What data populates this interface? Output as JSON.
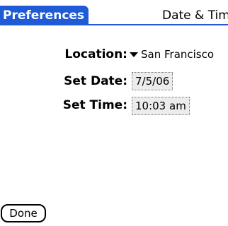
{
  "header": {
    "title": "Preferences",
    "category": "Date & Time"
  },
  "form": {
    "location": {
      "label": "Location:",
      "value": "San Francisco"
    },
    "date": {
      "label": "Set Date:",
      "value": "7/5/06"
    },
    "time": {
      "label": "Set Time:",
      "value": "10:03 am"
    }
  },
  "footer": {
    "done_label": "Done"
  },
  "colors": {
    "title_background": "#1f5bd6",
    "title_text": "#ffffff",
    "trigger_background": "#ececec"
  },
  "icons": {
    "location_dropdown": "triangle-down-icon"
  }
}
